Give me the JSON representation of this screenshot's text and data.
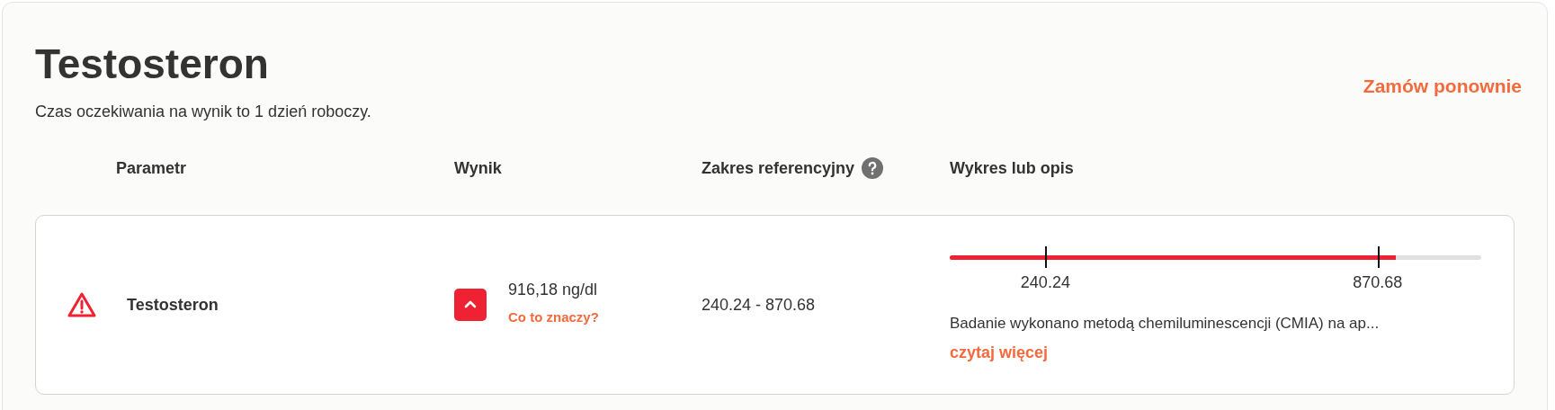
{
  "title": "Testosteron",
  "subtitle": "Czas oczekiwania na wynik to 1 dzień roboczy.",
  "reorder_link": "Zamów ponownie",
  "columns": [
    {
      "label": "Parametr",
      "help": false
    },
    {
      "label": "Wynik",
      "help": false
    },
    {
      "label": "Zakres referencyjny",
      "help": true
    },
    {
      "label": "Wykres lub opis",
      "help": false
    }
  ],
  "rows": [
    {
      "warning": true,
      "name": "Testosteron",
      "above_range": true,
      "value": "916,18 ng/dl",
      "explain_link": "Co to znaczy?",
      "range": "240.24 - 870.68",
      "gauge": {
        "level": 0.84,
        "low_label": "240.24",
        "high_label": "870.68"
      },
      "description": "Badanie wykonano metodą chemiluminescencji (CMIA) na ap...",
      "more_link": "czytaj więcej"
    }
  ]
}
